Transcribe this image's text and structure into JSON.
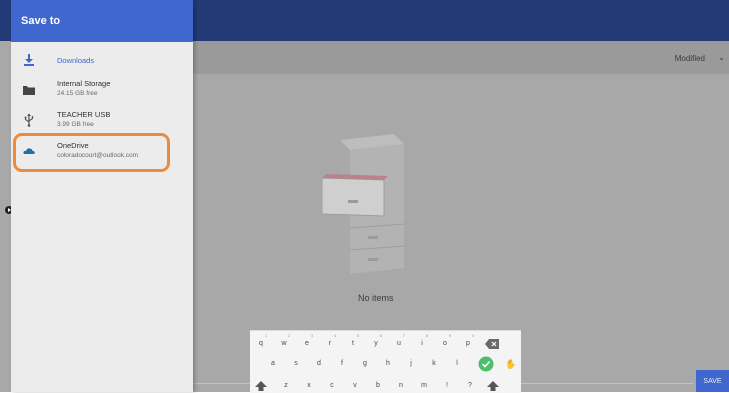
{
  "drawer": {
    "title": "Save to",
    "roots": [
      {
        "title": "Downloads",
        "summary": "",
        "icon": "download-icon"
      },
      {
        "title": "Internal Storage",
        "summary": "24.15 GB free",
        "icon": "folder-icon"
      },
      {
        "title": "TEACHER USB",
        "summary": "3.99 GB free",
        "icon": "usb-icon"
      },
      {
        "title": "OneDrive",
        "summary": "coloradocourt@outlook.com",
        "icon": "onedrive-cloud-icon"
      }
    ],
    "highlighted_root": "OneDrive"
  },
  "main": {
    "sort_label": "Modified",
    "empty_message": "No items",
    "save_label": "SAVE"
  },
  "keyboard": {
    "row1": [
      "q",
      "w",
      "e",
      "r",
      "t",
      "y",
      "u",
      "i",
      "o",
      "p"
    ],
    "row1_hints": [
      "1",
      "2",
      "3",
      "4",
      "5",
      "6",
      "7",
      "8",
      "9",
      "0"
    ],
    "row2": [
      "a",
      "s",
      "d",
      "f",
      "g",
      "h",
      "j",
      "k",
      "l"
    ],
    "row3": [
      "z",
      "x",
      "c",
      "v",
      "b",
      "n",
      "m",
      "!",
      "?"
    ]
  },
  "colors": {
    "header_blue": "#3f67cd",
    "topbar_navy": "#233a77",
    "highlight_orange": "#f08a3b",
    "enter_green": "#4cbf6b"
  }
}
